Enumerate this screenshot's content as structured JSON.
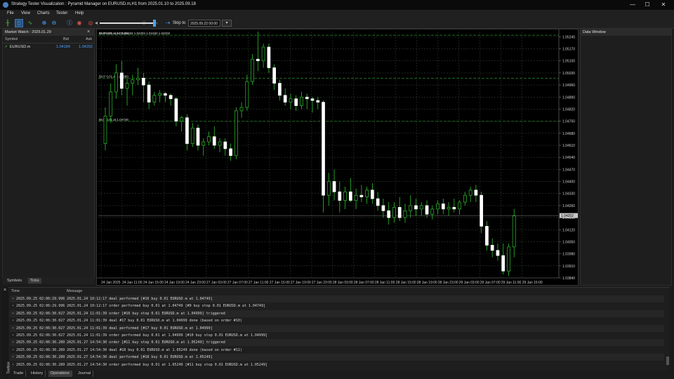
{
  "window": {
    "title": "Strategy Tester Visualization : Pyramid Manager on EURUSD.m,H1 from 2025.01.10 to 2025.09.18",
    "minimize": "—",
    "maximize": "☐",
    "close": "✕"
  },
  "menu": [
    "File",
    "View",
    "Charts",
    "Tester",
    "Help"
  ],
  "toolbar": {
    "skip_label": "Skip to",
    "skip_value": "2025.09.22 00:00"
  },
  "market_watch": {
    "header": "Market Watch : 2025.01.29",
    "columns": [
      "Symbol",
      "Bid",
      "Ask"
    ],
    "rows": [
      {
        "symbol": "EURUSD.m",
        "bid": "1.04184",
        "ask": "1.04202"
      }
    ],
    "tabs": [
      "Symbols",
      "Ticks"
    ]
  },
  "chart": {
    "info": "EURUSD.m,H1  1.04183 1.04204 1.04183 1.04202",
    "lines": [
      {
        "label": "BUY 0.01 at 1.05249",
        "price": 1.05249
      },
      {
        "label": "BUY 0.01 at 1.04999",
        "price": 1.04999
      },
      {
        "label": "BUY 0.01 at 1.04749",
        "price": 1.04749
      }
    ],
    "current_price_label": "1.04202",
    "price_ticks": [
      "1.05240",
      "1.05170",
      "1.05100",
      "1.05030",
      "1.04960",
      "1.04890",
      "1.04820",
      "1.04750",
      "1.04680",
      "1.04610",
      "1.04540",
      "1.04470",
      "1.04400",
      "1.04330",
      "1.04260",
      "1.04190",
      "1.04120",
      "1.04050",
      "1.03980",
      "1.03910",
      "1.03840"
    ],
    "time_ticks": [
      "24 Jan 2025",
      "24 Jan 11:00",
      "24 Jan 15:00",
      "24 Jan 19:00",
      "24 Jan 23:00",
      "27 Jan 03:00",
      "27 Jan 07:00",
      "27 Jan 11:00",
      "27 Jan 15:00",
      "27 Jan 19:00",
      "27 Jan 23:00",
      "28 Jan 03:00",
      "28 Jan 07:00",
      "28 Jan 11:00",
      "28 Jan 15:00",
      "28 Jan 19:00",
      "28 Jan 23:00",
      "29 Jan 03:00",
      "29 Jan 07:00",
      "29 Jan 11:00",
      "29 Jan 15:00"
    ],
    "colors": {
      "bull": "#ffffff",
      "bear": "#ffffff",
      "wick": "#2fbf2f",
      "grid": "#2e3b2e",
      "trade_line": "#2a8a2a"
    }
  },
  "data_window": {
    "header": "Data Window"
  },
  "toolbox": {
    "side_label": "Toolbox",
    "columns": [
      "Time",
      "Message"
    ],
    "rows": [
      {
        "time": "2025.09.25 02:06:29.996",
        "message": "2025.01.24 10:12:17   deal performed [#16 buy 0.01 EURUSD.m at 1.04749]"
      },
      {
        "time": "2025.09.25 02:06:29.996",
        "message": "2025.01.24 10:12:17   order performed buy 0.01 at 1.04749 [#9 buy stop 0.01 EURUSD.m at 1.04749]"
      },
      {
        "time": "2025.09.25 02:06:30.027",
        "message": "2025.01.24 11:01:39   order [#10 buy stop 0.01 EURUSD.m at 1.04999] triggered"
      },
      {
        "time": "2025.09.25 02:06:30.027",
        "message": "2025.01.24 11:01:39   deal #17 buy 0.01 EURUSD.m at 1.04999 done (based on order #10)"
      },
      {
        "time": "2025.09.25 02:06:30.027",
        "message": "2025.01.24 11:01:39   deal performed [#17 buy 0.01 EURUSD.m at 1.04999]"
      },
      {
        "time": "2025.09.25 02:06:30.027",
        "message": "2025.01.24 11:01:39   order performed buy 0.01 at 1.04999 [#10 buy stop 0.01 EURUSD.m at 1.04999]"
      },
      {
        "time": "2025.09.25 02:06:30.289",
        "message": "2025.01.27 14:54:30   order [#11 buy stop 0.01 EURUSD.m at 1.05249] triggered"
      },
      {
        "time": "2025.09.25 02:06:30.289",
        "message": "2025.01.27 14:54:30   deal #18 buy 0.01 EURUSD.m at 1.05249 done (based on order #11)"
      },
      {
        "time": "2025.09.25 02:06:30.289",
        "message": "2025.01.27 14:54:30   deal performed [#18 buy 0.01 EURUSD.m at 1.05249]"
      },
      {
        "time": "2025.09.25 02:06:30.289",
        "message": "2025.01.27 14:54:30   order performed buy 0.01 at 1.05249 [#11 buy stop 0.01 EURUSD.m at 1.05249]"
      }
    ],
    "tabs": [
      "Trade",
      "History",
      "Operations",
      "Journal"
    ]
  },
  "chart_data": {
    "type": "candlestick",
    "symbol": "EURUSD.m",
    "timeframe": "H1",
    "ylim": [
      1.0384,
      1.0527
    ],
    "candles": [
      [
        1.0462,
        1.0483,
        1.0458,
        1.0478
      ],
      [
        1.0478,
        1.0497,
        1.0474,
        1.0492
      ],
      [
        1.0492,
        1.0508,
        1.0488,
        1.0503
      ],
      [
        1.0503,
        1.051,
        1.049,
        1.0494
      ],
      [
        1.0494,
        1.05,
        1.0484,
        1.0497
      ],
      [
        1.0497,
        1.0502,
        1.049,
        1.0499
      ],
      [
        1.0499,
        1.0506,
        1.0496,
        1.05
      ],
      [
        1.05,
        1.0503,
        1.0486,
        1.0496
      ],
      [
        1.0496,
        1.0498,
        1.0482,
        1.0486
      ],
      [
        1.0486,
        1.0492,
        1.0484,
        1.049
      ],
      [
        1.049,
        1.0493,
        1.0486,
        1.0491
      ],
      [
        1.0491,
        1.0492,
        1.0486,
        1.049
      ],
      [
        1.049,
        1.0491,
        1.0484,
        1.0488
      ],
      [
        1.0488,
        1.0489,
        1.0472,
        1.0475
      ],
      [
        1.0475,
        1.0478,
        1.0469,
        1.0477
      ],
      [
        1.0477,
        1.0479,
        1.0458,
        1.0462
      ],
      [
        1.0462,
        1.0474,
        1.046,
        1.0471
      ],
      [
        1.0471,
        1.0473,
        1.0458,
        1.0461
      ],
      [
        1.0461,
        1.0465,
        1.0455,
        1.0463
      ],
      [
        1.0463,
        1.0469,
        1.0461,
        1.0466
      ],
      [
        1.0466,
        1.0472,
        1.0459,
        1.0461
      ],
      [
        1.0461,
        1.0465,
        1.0457,
        1.0463
      ],
      [
        1.0463,
        1.0465,
        1.0455,
        1.0459
      ],
      [
        1.0459,
        1.0462,
        1.0452,
        1.0455
      ],
      [
        1.0455,
        1.0483,
        1.0453,
        1.0481
      ],
      [
        1.0481,
        1.0486,
        1.0477,
        1.0483
      ],
      [
        1.0483,
        1.0502,
        1.0481,
        1.0498
      ],
      [
        1.0498,
        1.0514,
        1.0496,
        1.0511
      ],
      [
        1.0511,
        1.0527,
        1.0504,
        1.051
      ],
      [
        1.051,
        1.052,
        1.0506,
        1.0518
      ],
      [
        1.0518,
        1.052,
        1.0503,
        1.0506
      ],
      [
        1.0506,
        1.0508,
        1.0493,
        1.0497
      ],
      [
        1.0497,
        1.0499,
        1.0487,
        1.049
      ],
      [
        1.049,
        1.0494,
        1.0484,
        1.0486
      ],
      [
        1.0486,
        1.0491,
        1.0482,
        1.0488
      ],
      [
        1.0488,
        1.049,
        1.0481,
        1.0484
      ],
      [
        1.0484,
        1.0492,
        1.0482,
        1.0489
      ],
      [
        1.0489,
        1.0491,
        1.0482,
        1.0488
      ],
      [
        1.0488,
        1.0489,
        1.048,
        1.0487
      ],
      [
        1.0487,
        1.0489,
        1.0482,
        1.0486
      ],
      [
        1.0486,
        1.0487,
        1.0422,
        1.0432
      ],
      [
        1.0432,
        1.0445,
        1.0426,
        1.044
      ],
      [
        1.044,
        1.0447,
        1.0429,
        1.0434
      ],
      [
        1.0434,
        1.044,
        1.0422,
        1.0429
      ],
      [
        1.0429,
        1.0437,
        1.0424,
        1.0434
      ],
      [
        1.0434,
        1.0442,
        1.0428,
        1.0429
      ],
      [
        1.0429,
        1.0436,
        1.0424,
        1.0432
      ],
      [
        1.0432,
        1.0438,
        1.0428,
        1.0431
      ],
      [
        1.0431,
        1.0437,
        1.0427,
        1.0435
      ],
      [
        1.0435,
        1.0439,
        1.0427,
        1.043
      ],
      [
        1.043,
        1.0434,
        1.0423,
        1.0426
      ],
      [
        1.0426,
        1.043,
        1.0419,
        1.0423
      ],
      [
        1.0423,
        1.0428,
        1.0415,
        1.0419
      ],
      [
        1.0419,
        1.0428,
        1.0416,
        1.0425
      ],
      [
        1.0425,
        1.0431,
        1.0417,
        1.0419
      ],
      [
        1.0419,
        1.0427,
        1.0416,
        1.0423
      ],
      [
        1.0423,
        1.0432,
        1.0419,
        1.0426
      ],
      [
        1.0426,
        1.043,
        1.042,
        1.0424
      ],
      [
        1.0424,
        1.0428,
        1.042,
        1.0426
      ],
      [
        1.0426,
        1.0429,
        1.0419,
        1.0421
      ],
      [
        1.0421,
        1.0426,
        1.0418,
        1.0424
      ],
      [
        1.0424,
        1.0429,
        1.0421,
        1.0427
      ],
      [
        1.0427,
        1.043,
        1.0421,
        1.0424
      ],
      [
        1.0424,
        1.0428,
        1.042,
        1.0425
      ],
      [
        1.0425,
        1.043,
        1.0422,
        1.0424
      ],
      [
        1.0424,
        1.0429,
        1.0421,
        1.0428
      ],
      [
        1.0428,
        1.0434,
        1.0426,
        1.0432
      ],
      [
        1.0432,
        1.0437,
        1.0428,
        1.0435
      ],
      [
        1.0435,
        1.0438,
        1.0428,
        1.0432
      ],
      [
        1.0432,
        1.0434,
        1.041,
        1.0414
      ],
      [
        1.0414,
        1.0417,
        1.04,
        1.0403
      ],
      [
        1.0403,
        1.0407,
        1.0396,
        1.04
      ],
      [
        1.04,
        1.0404,
        1.0394,
        1.0397
      ],
      [
        1.0397,
        1.0404,
        1.0386,
        1.0388
      ],
      [
        1.0388,
        1.0404,
        1.0385,
        1.0402
      ],
      [
        1.0402,
        1.0424,
        1.0396,
        1.042
      ]
    ]
  }
}
